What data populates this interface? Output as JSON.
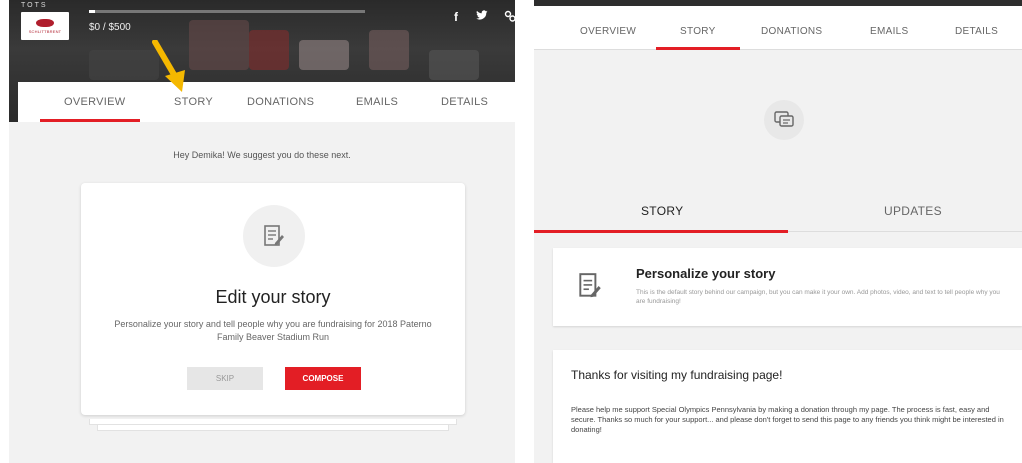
{
  "left": {
    "logo_top": "TOTS",
    "logo_text": "SCHLITTBRENT",
    "progress": {
      "text": "$0 / $500",
      "fraction": 0
    },
    "social": {
      "facebook": "f",
      "twitter": "t",
      "link": "link"
    },
    "tabs": [
      "OVERVIEW",
      "STORY",
      "DONATIONS",
      "EMAILS",
      "DETAILS"
    ],
    "active_tab": "OVERVIEW",
    "suggestion": "Hey Demika! We suggest you do these next.",
    "card": {
      "title": "Edit your story",
      "description": "Personalize your story and tell people why you are fundraising for 2018 Paterno Family Beaver Stadium Run",
      "skip_label": "SKIP",
      "compose_label": "COMPOSE"
    },
    "annotation_color": "#f5b800"
  },
  "right": {
    "tabs": [
      "OVERVIEW",
      "STORY",
      "DONATIONS",
      "EMAILS",
      "DETAILS"
    ],
    "active_tab": "STORY",
    "subtabs": [
      "STORY",
      "UPDATES"
    ],
    "active_subtab": "STORY",
    "personalize": {
      "title": "Personalize your story",
      "description": "This is the default story behind our campaign, but you can make it your own. Add photos, video, and text to tell people why you are fundraising!"
    },
    "story": {
      "title": "Thanks for visiting my fundraising page!",
      "body": "Please help me support Special Olympics Pennsylvania by making a donation through my page. The process is fast, easy and secure. Thanks so much for your support... and please don't forget to send this page to any friends you think might be interested in donating!"
    }
  },
  "colors": {
    "accent": "#e31e25",
    "background": "#f2f2f2"
  },
  "icons": [
    "document-edit-icon",
    "chat-bubble-icon",
    "facebook-icon",
    "twitter-icon",
    "link-icon",
    "arrow-annotation-icon"
  ]
}
